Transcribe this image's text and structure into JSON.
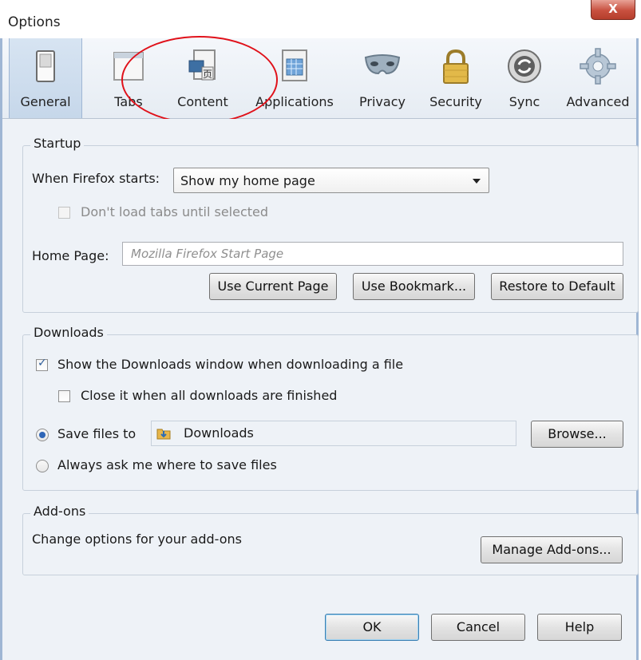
{
  "window": {
    "title": "Options",
    "close_label": "X"
  },
  "toolbar": {
    "items": [
      {
        "label": "General",
        "icon": "general-switch-icon"
      },
      {
        "label": "Tabs",
        "icon": "tabs-window-icon"
      },
      {
        "label": "Content",
        "icon": "content-page-icon"
      },
      {
        "label": "Applications",
        "icon": "applications-icon"
      },
      {
        "label": "Privacy",
        "icon": "privacy-mask-icon"
      },
      {
        "label": "Security",
        "icon": "security-lock-icon"
      },
      {
        "label": "Sync",
        "icon": "sync-icon"
      },
      {
        "label": "Advanced",
        "icon": "advanced-gear-icon"
      }
    ],
    "selected": "General"
  },
  "startup": {
    "title": "Startup",
    "when_starts_label": "When Firefox starts:",
    "when_starts_value": "Show my home page",
    "dont_load_tabs_label": "Don't load tabs until selected",
    "home_page_label": "Home Page:",
    "home_page_placeholder": "Mozilla Firefox Start Page",
    "use_current_page": "Use Current Page",
    "use_bookmark": "Use Bookmark...",
    "restore_default": "Restore to Default"
  },
  "downloads": {
    "title": "Downloads",
    "show_window_label": "Show the Downloads window when downloading a file",
    "close_when_done_label": "Close it when all downloads are finished",
    "save_files_label": "Save files to",
    "save_folder": "Downloads",
    "browse": "Browse...",
    "always_ask_label": "Always ask me where to save files"
  },
  "addons": {
    "title": "Add-ons",
    "description": "Change options for your add-ons",
    "manage_button": "Manage Add-ons..."
  },
  "footer": {
    "ok": "OK",
    "cancel": "Cancel",
    "help": "Help"
  },
  "colors": {
    "selected_tab": "#c6d7ea",
    "dialog_bg": "#eef2f7",
    "annotation": "#e0111a",
    "close_btn": "#c8503f"
  }
}
